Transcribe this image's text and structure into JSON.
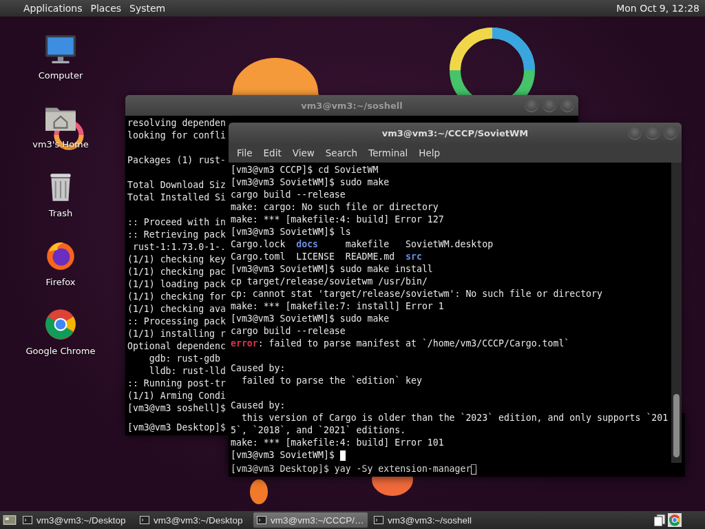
{
  "top_panel": {
    "menus": [
      "Applications",
      "Places",
      "System"
    ],
    "clock": "Mon Oct 9, 12:28"
  },
  "desktop_icons": [
    {
      "label": "Computer",
      "kind": "computer"
    },
    {
      "label": "vm3's Home",
      "kind": "home"
    },
    {
      "label": "Trash",
      "kind": "trash"
    },
    {
      "label": "Firefox",
      "kind": "firefox"
    },
    {
      "label": "Google Chrome",
      "kind": "chrome"
    }
  ],
  "windows": [
    {
      "kind": "strip",
      "lines": [
        {
          "text": "[vm3@vm3 Desktop]$"
        }
      ]
    },
    {
      "kind": "strip",
      "focused": false,
      "lines": [
        {
          "text": "[vm3@vm3 Desktop]$ yay -Sy extension-manager",
          "cursor": true
        }
      ]
    },
    {
      "kind": "terminal",
      "focused": false,
      "title": "vm3@vm3:~/soshell",
      "lines": [
        {
          "text": "resolving dependen"
        },
        {
          "text": "looking for confli"
        },
        {
          "kind": "blank"
        },
        {
          "text": "Packages (1) rust-"
        },
        {
          "kind": "blank"
        },
        {
          "text": "Total Download Siz"
        },
        {
          "text": "Total Installed Si"
        },
        {
          "kind": "blank"
        },
        {
          "text": ":: Proceed with in"
        },
        {
          "text": ":: Retrieving pack"
        },
        {
          "text": " rust-1:1.73.0-1-."
        },
        {
          "text": "(1/1) checking key"
        },
        {
          "text": "(1/1) checking pac"
        },
        {
          "text": "(1/1) loading pack"
        },
        {
          "text": "(1/1) checking for"
        },
        {
          "text": "(1/1) checking ava"
        },
        {
          "text": ":: Processing pack"
        },
        {
          "text": "(1/1) installing r"
        },
        {
          "text": "Optional dependenc"
        },
        {
          "text": "    gdb: rust-gdb"
        },
        {
          "text": "    lldb: rust-lld"
        },
        {
          "text": ":: Running post-tr"
        },
        {
          "text": "(1/1) Arming Condi"
        },
        {
          "text": "[vm3@vm3 soshell]$"
        }
      ]
    },
    {
      "kind": "terminal",
      "focused": true,
      "title": "vm3@vm3:~/CCCP/SovietWM",
      "menu": [
        "File",
        "Edit",
        "View",
        "Search",
        "Terminal",
        "Help"
      ],
      "lines": [
        {
          "text": "[vm3@vm3 CCCP]$ cd SovietWM"
        },
        {
          "text": "[vm3@vm3 SovietWM]$ sudo make"
        },
        {
          "text": "cargo build --release"
        },
        {
          "text": "make: cargo: No such file or directory"
        },
        {
          "text": "make: *** [makefile:4: build] Error 127"
        },
        {
          "text": "[vm3@vm3 SovietWM]$ ls"
        },
        {
          "parts": [
            {
              "text": "Cargo.lock  ",
              "kind": "plain"
            },
            {
              "text": "docs",
              "kind": "dir"
            },
            {
              "text": "     makefile   SovietWM.desktop",
              "kind": "plain"
            }
          ]
        },
        {
          "parts": [
            {
              "text": "Cargo.toml  LICENSE  README.md  ",
              "kind": "plain"
            },
            {
              "text": "src",
              "kind": "dir"
            }
          ]
        },
        {
          "text": "[vm3@vm3 SovietWM]$ sudo make install"
        },
        {
          "text": "cp target/release/sovietwm /usr/bin/"
        },
        {
          "text": "cp: cannot stat 'target/release/sovietwm': No such file or directory"
        },
        {
          "text": "make: *** [makefile:7: install] Error 1"
        },
        {
          "text": "[vm3@vm3 SovietWM]$ sudo make"
        },
        {
          "text": "cargo build --release"
        },
        {
          "parts": [
            {
              "text": "error",
              "kind": "error"
            },
            {
              "text": ": failed to parse manifest at `/home/vm3/CCCP/Cargo.toml`",
              "kind": "plain"
            }
          ]
        },
        {
          "kind": "blank"
        },
        {
          "text": "Caused by:"
        },
        {
          "text": "  failed to parse the `edition` key"
        },
        {
          "kind": "blank"
        },
        {
          "text": "Caused by:"
        },
        {
          "text": "  this version of Cargo is older than the `2023` edition, and only supports `201"
        },
        {
          "text": "5`, `2018`, and `2021` editions."
        },
        {
          "text": "make: *** [makefile:4: build] Error 101"
        },
        {
          "text": "[vm3@vm3 SovietWM]$ ",
          "cursor": true
        }
      ]
    }
  ],
  "taskbar": {
    "tasks": [
      {
        "label": "vm3@vm3:~/Desktop",
        "selected": false
      },
      {
        "label": "vm3@vm3:~/Desktop",
        "selected": false
      },
      {
        "label": "vm3@vm3:~/CCCP/…",
        "selected": true
      },
      {
        "label": "vm3@vm3:~/soshell",
        "selected": false
      }
    ]
  }
}
